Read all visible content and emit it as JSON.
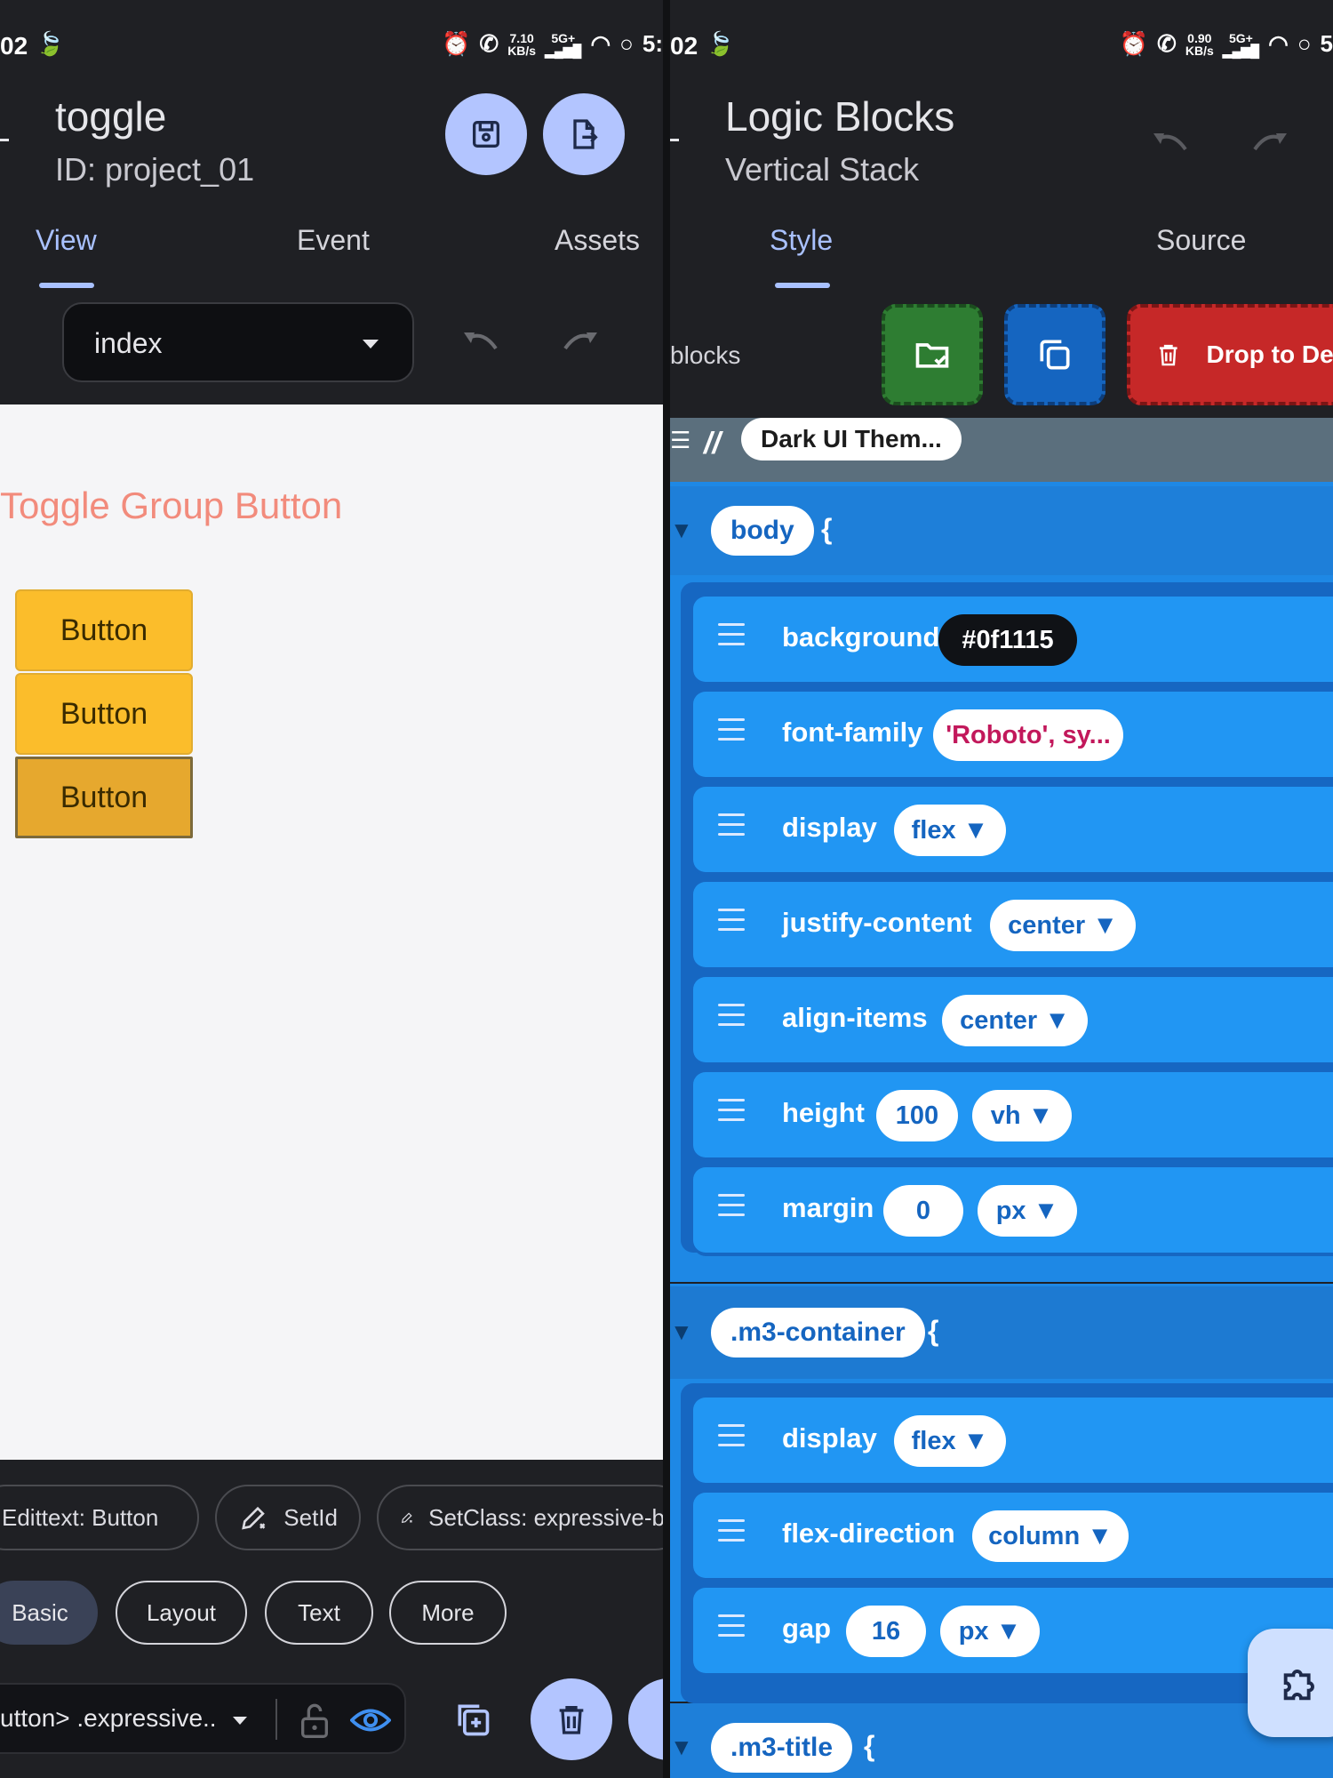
{
  "left": {
    "status": {
      "time": "02",
      "speed_top": "7.10",
      "speed_unit": "KB/s",
      "net": "5G+",
      "time_right": "5:"
    },
    "header": {
      "title": "toggle",
      "subtitle": "ID: project_01"
    },
    "tabs": [
      {
        "label": "View",
        "active": true
      },
      {
        "label": "Event",
        "active": false
      },
      {
        "label": "Assets",
        "active": false
      }
    ],
    "page_select": {
      "value": "index"
    },
    "preview": {
      "title": "Toggle Group Button",
      "buttons": [
        "Button",
        "Button",
        "Button"
      ]
    },
    "actions": [
      "Edittext: Button",
      "SetId",
      "SetClass: expressive-b"
    ],
    "categories": [
      {
        "label": "Basic",
        "active": true
      },
      {
        "label": "Layout",
        "active": false
      },
      {
        "label": "Text",
        "active": false
      },
      {
        "label": "More",
        "active": false
      }
    ],
    "breadcrumb": "utton> .expressive.."
  },
  "right": {
    "status": {
      "time": "02",
      "speed_top": "0.90",
      "speed_unit": "KB/s",
      "net": "5G+",
      "time_right": "5"
    },
    "header": {
      "title": "Logic Blocks",
      "subtitle": "Vertical Stack"
    },
    "tabs": [
      {
        "label": "Style",
        "active": true
      },
      {
        "label": "Source",
        "active": false
      }
    ],
    "toolbar": {
      "label": "blocks",
      "delete_label": "Drop to Dele"
    },
    "comment": {
      "mark": "//",
      "text": "Dark UI Them..."
    },
    "rules": [
      {
        "selector": "body",
        "brace": "{",
        "props": [
          {
            "name": "background",
            "values": [
              "#0f1115"
            ]
          },
          {
            "name": "font-family",
            "values": [
              "'Roboto', sy..."
            ]
          },
          {
            "name": "display",
            "values": [
              "flex ▼"
            ]
          },
          {
            "name": "justify-content",
            "values": [
              "center ▼"
            ]
          },
          {
            "name": "align-items",
            "values": [
              "center ▼"
            ]
          },
          {
            "name": "height",
            "values": [
              "100",
              "vh ▼"
            ]
          },
          {
            "name": "margin",
            "values": [
              "0",
              "px ▼"
            ]
          }
        ]
      },
      {
        "selector": ".m3-container",
        "brace": "{",
        "props": [
          {
            "name": "display",
            "values": [
              "flex ▼"
            ]
          },
          {
            "name": "flex-direction",
            "values": [
              "column ▼"
            ]
          },
          {
            "name": "gap",
            "values": [
              "16",
              "px ▼"
            ]
          }
        ]
      },
      {
        "selector": ".m3-title",
        "brace": "{"
      }
    ]
  },
  "colors": {
    "accent": "#a9c1ff",
    "button_yellow": "#fbbd2b",
    "block_blue": "#2196f3",
    "green": "#2e7d32",
    "red": "#c62828"
  }
}
